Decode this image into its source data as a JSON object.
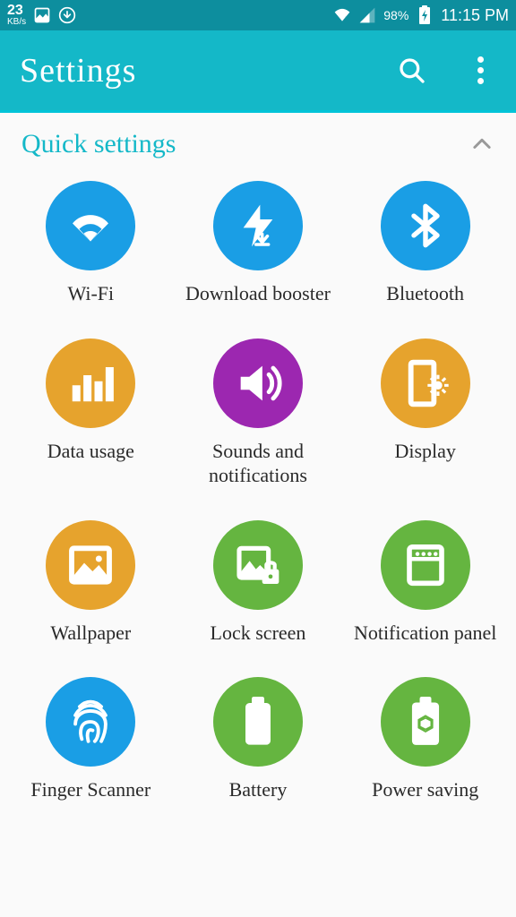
{
  "status_bar": {
    "kbs_value": "23",
    "kbs_unit": "KB/s",
    "battery_pct": "98%",
    "time": "11:15 PM"
  },
  "action_bar": {
    "title": "Settings"
  },
  "section": {
    "title": "Quick settings"
  },
  "tiles": {
    "wifi": "Wi-Fi",
    "download_booster": "Download booster",
    "bluetooth": "Bluetooth",
    "data_usage": "Data usage",
    "sounds": "Sounds and notifications",
    "display": "Display",
    "wallpaper": "Wallpaper",
    "lock_screen": "Lock screen",
    "notification_panel": "Notification panel",
    "finger_scanner": "Finger Scanner",
    "battery": "Battery",
    "power_saving": "Power saving"
  }
}
